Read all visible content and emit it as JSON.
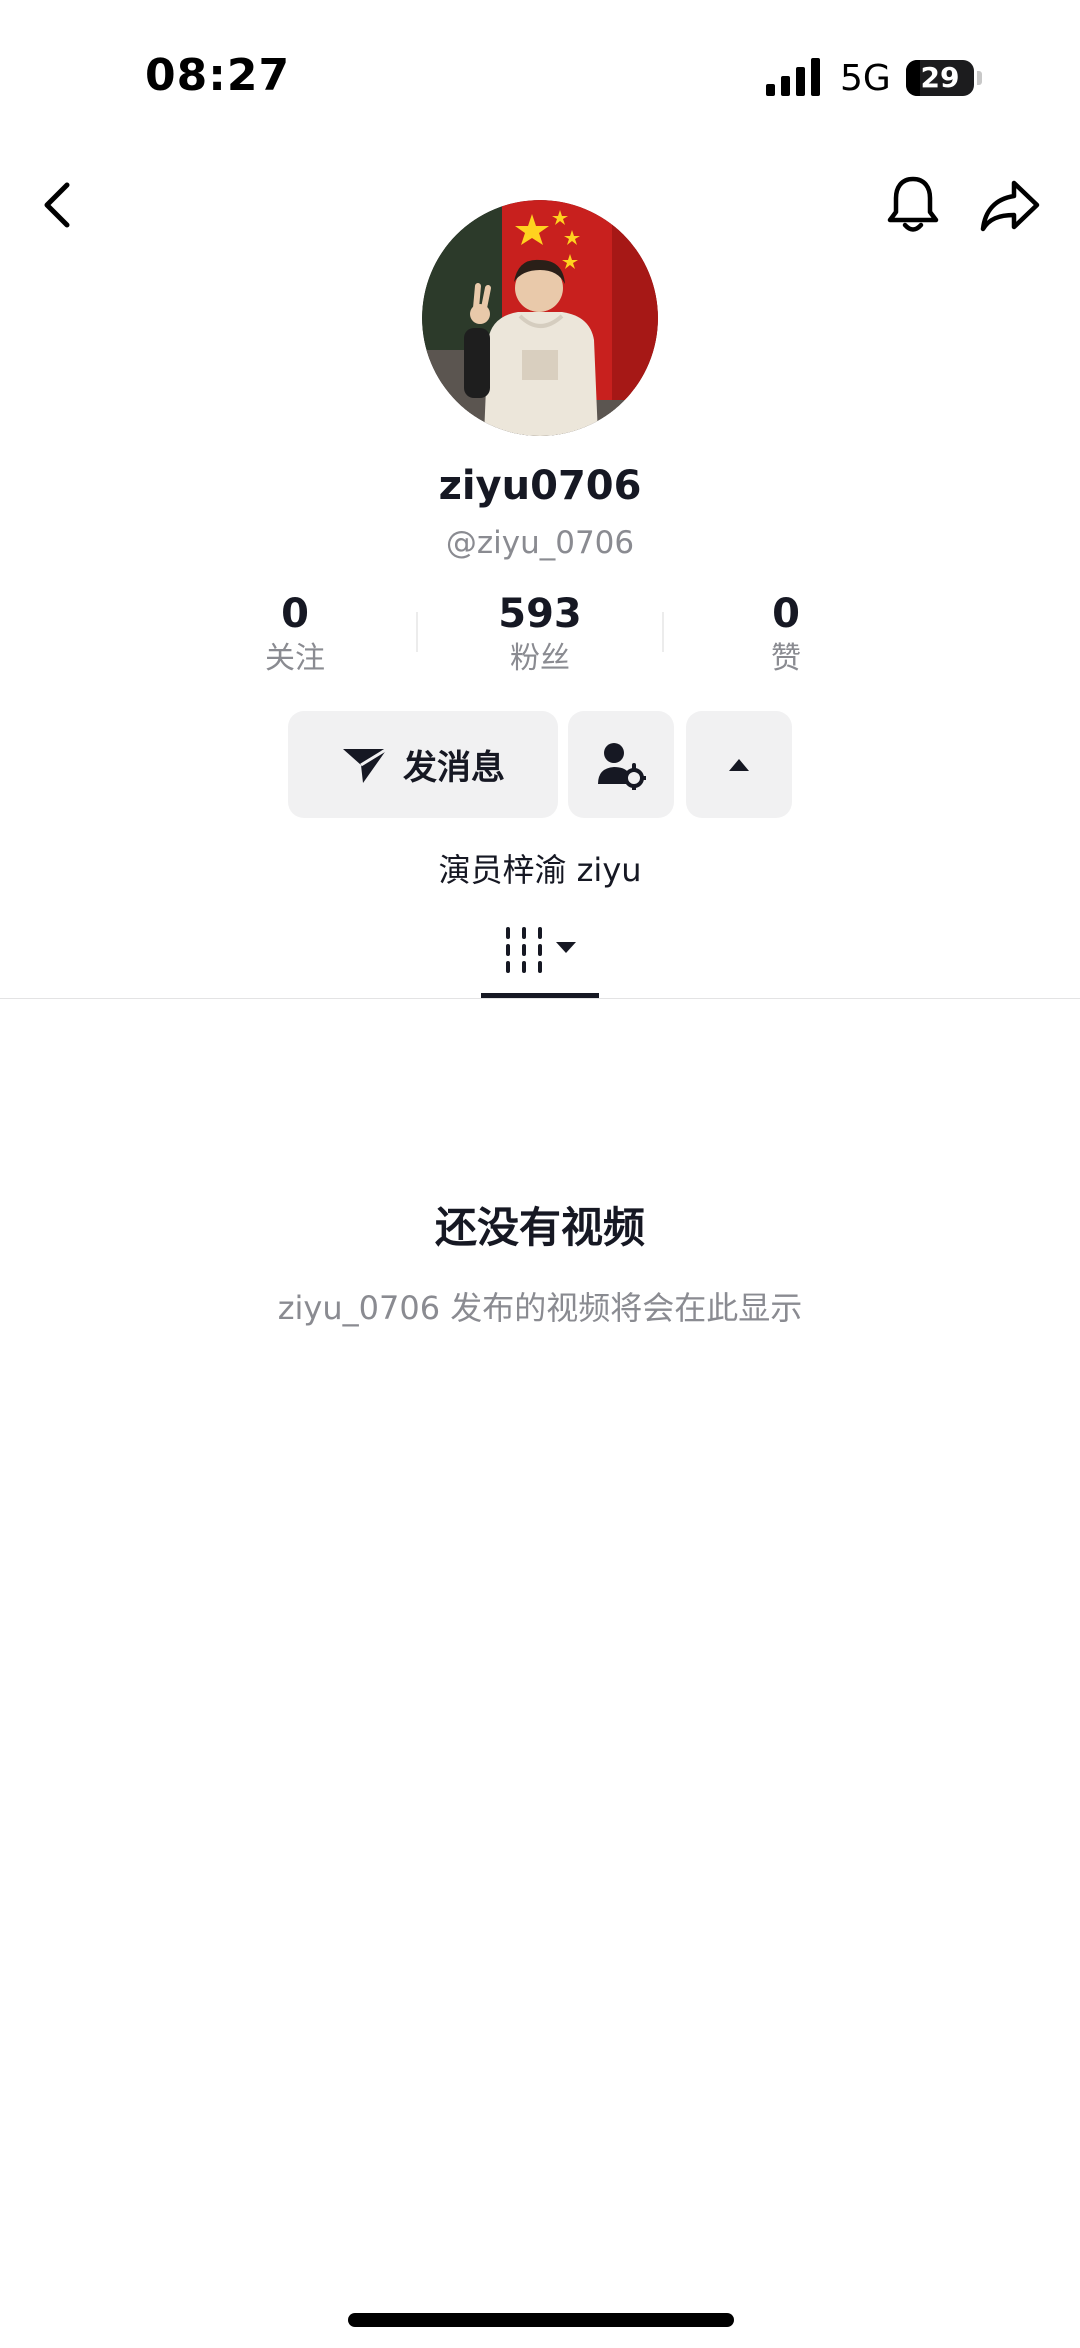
{
  "status_bar": {
    "time": "08:27",
    "network": "5G",
    "battery_level": "29",
    "signal_icon": "signal-bars-icon",
    "battery_icon": "battery-icon"
  },
  "nav": {
    "back_icon": "chevron-left-icon",
    "bell_icon": "bell-icon",
    "share_icon": "share-arrow-icon"
  },
  "profile": {
    "avatar": "profile-photo",
    "username": "ziyu0706",
    "handle": "@ziyu_0706",
    "bio": "演员梓渝 ziyu"
  },
  "stats": [
    {
      "value": "0",
      "label": "关注"
    },
    {
      "value": "593",
      "label": "粉丝"
    },
    {
      "value": "0",
      "label": "赞"
    }
  ],
  "actions": {
    "message_label": "发消息",
    "message_icon": "send-icon",
    "user_settings_icon": "user-gear-icon",
    "more_icon": "caret-up-icon"
  },
  "tabs": {
    "videos_icon": "grid-filter-icon"
  },
  "empty_state": {
    "title": "还没有视频",
    "subtitle": "ziyu_0706 发布的视频将会在此显示"
  },
  "colors": {
    "text_primary": "#161823",
    "text_secondary": "#8a8b91",
    "button_bg": "#f1f1f2",
    "background": "#ffffff"
  }
}
